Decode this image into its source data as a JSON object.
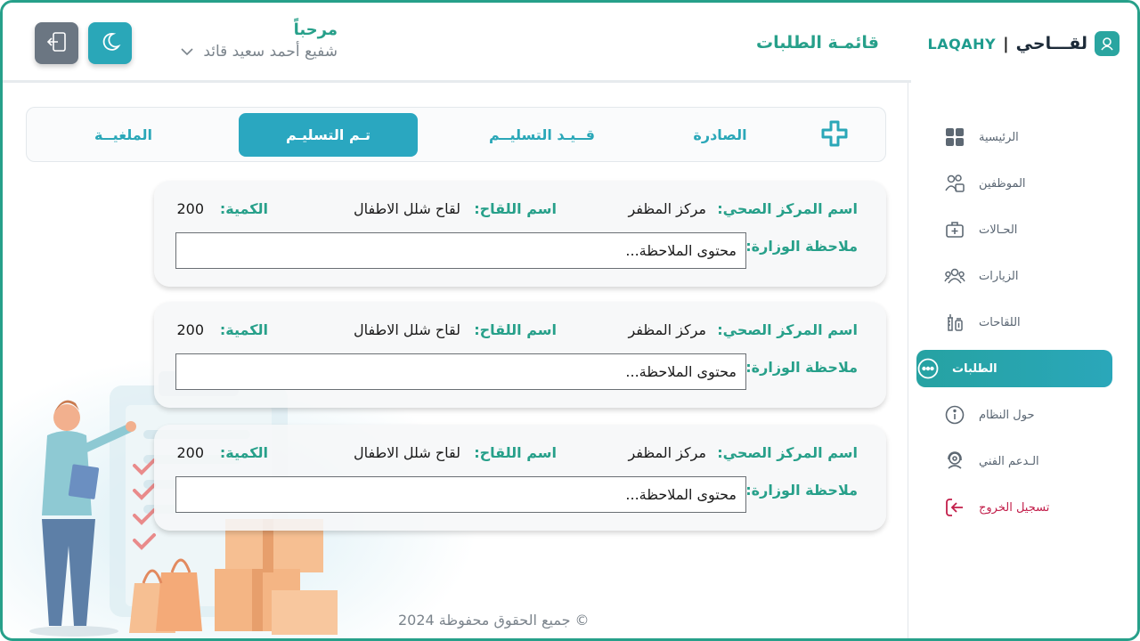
{
  "brand": {
    "name_en": "LAQAHY",
    "separator": "|",
    "name_ar": "لقـــاحي"
  },
  "colors": {
    "primary": "#27a08a",
    "accent": "#2aa7b8",
    "logout": "#c21e4a"
  },
  "header": {
    "page_title": "قائمـة الطلبات",
    "welcome": "مرحباً",
    "user_name": "شفيع أحمد سعيد قائد"
  },
  "sidebar": {
    "items": [
      {
        "label": "الرئيسية",
        "icon": "grid-icon"
      },
      {
        "label": "الموظفين",
        "icon": "employees-icon"
      },
      {
        "label": "الحـالات",
        "icon": "medical-case-icon"
      },
      {
        "label": "الزيارات",
        "icon": "visits-icon"
      },
      {
        "label": "اللقاحات",
        "icon": "vaccine-icon"
      },
      {
        "label": "الطلبات",
        "icon": "chat-dots-icon"
      },
      {
        "label": "حول النظام",
        "icon": "info-icon"
      },
      {
        "label": "الـدعم الفني",
        "icon": "support-icon"
      },
      {
        "label": "تسجيل الخروج",
        "icon": "logout-icon"
      }
    ]
  },
  "tabs": [
    {
      "label": "الصادرة"
    },
    {
      "label": "قــيـد التسليــم"
    },
    {
      "label": "تـم التسليـم"
    },
    {
      "label": "الملغيــة"
    }
  ],
  "labels": {
    "center": "اسم المركز الصحي:",
    "vaccine": "اسم اللقاح:",
    "quantity": "الكمية:",
    "note": "ملاحظة الوزارة:"
  },
  "orders": [
    {
      "center": "مركز المظفر",
      "vaccine": "لقاح شلل الاطفال",
      "quantity": "200",
      "note": "محتوى الملاحظة..."
    },
    {
      "center": "مركز المظفر",
      "vaccine": "لقاح شلل الاطفال",
      "quantity": "200",
      "note": "محتوى الملاحظة..."
    },
    {
      "center": "مركز المظفر",
      "vaccine": "لقاح شلل الاطفال",
      "quantity": "200",
      "note": "محتوى الملاحظة..."
    }
  ],
  "footer": "جميع الحقوق محفوظة 2024 ©"
}
